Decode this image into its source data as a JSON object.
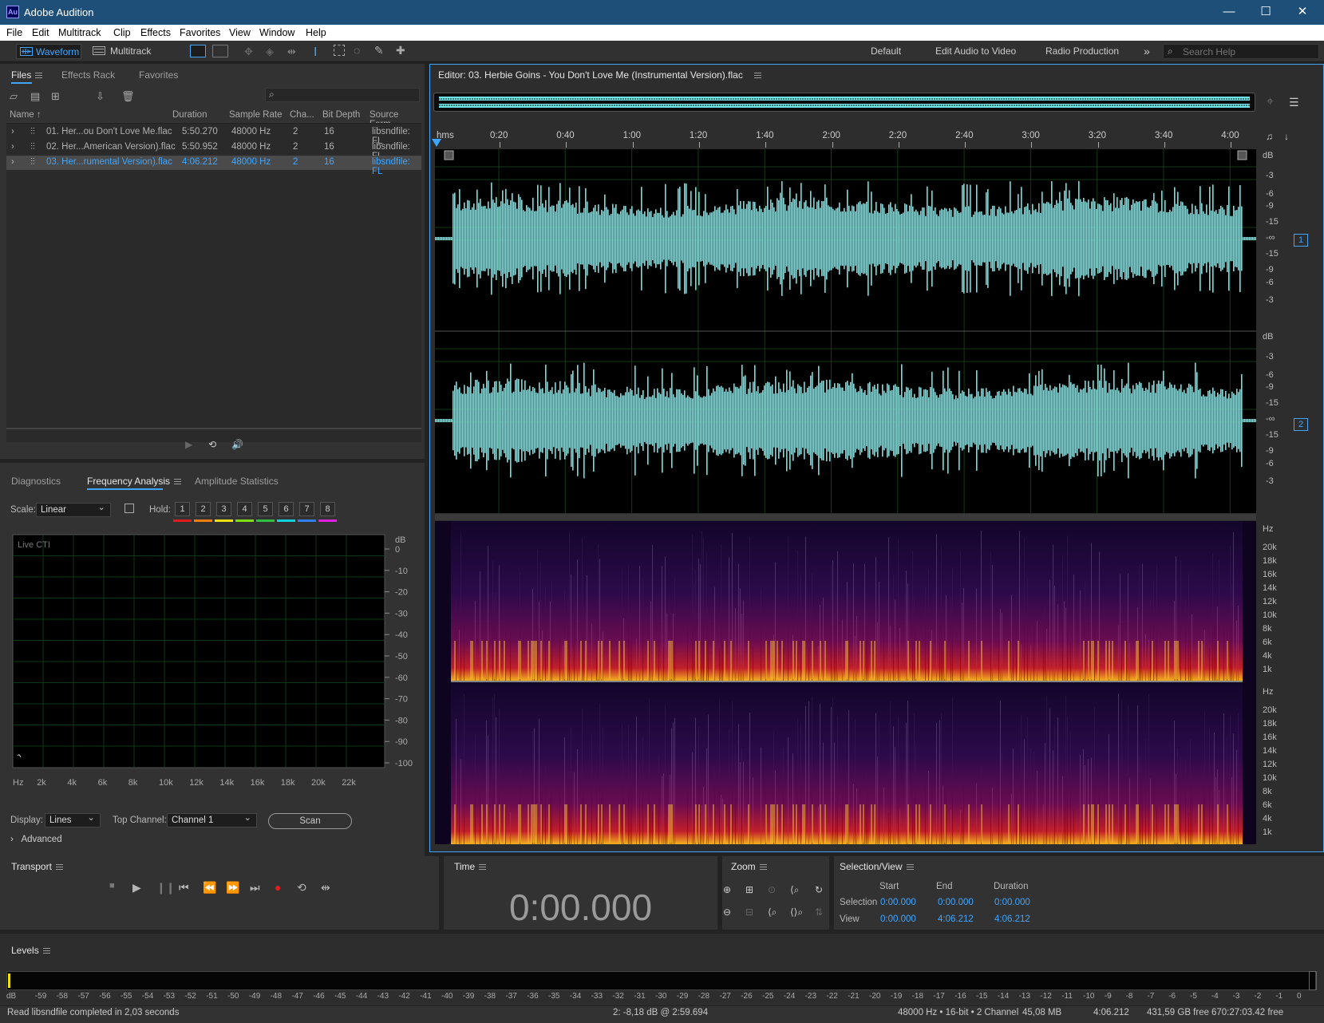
{
  "app": {
    "title": "Adobe Audition",
    "logo": "Au"
  },
  "window_controls": [
    "—",
    "☐",
    "✕"
  ],
  "menu": [
    "File",
    "Edit",
    "Multitrack",
    "Clip",
    "Effects",
    "Favorites",
    "View",
    "Window",
    "Help"
  ],
  "toolbar": {
    "waveform": "Waveform",
    "multitrack": "Multitrack",
    "workspaces": [
      "Default",
      "Edit Audio to Video",
      "Radio Production"
    ],
    "more": "»",
    "search_placeholder": "Search Help"
  },
  "files_panel": {
    "tabs": [
      "Files",
      "Effects Rack",
      "Favorites"
    ],
    "columns": [
      "Name ↑",
      "Duration",
      "Sample Rate",
      "Cha...",
      "Bit Depth",
      "Source Form..."
    ],
    "rows": [
      {
        "name": "01. Her...ou Don't Love Me.flac",
        "duration": "5:50.270",
        "rate": "48000 Hz",
        "ch": "2",
        "bits": "16",
        "src": "libsndfile: FL"
      },
      {
        "name": "02. Her...American Version).flac",
        "duration": "5:50.952",
        "rate": "48000 Hz",
        "ch": "2",
        "bits": "16",
        "src": "libsndfile: FL"
      },
      {
        "name": "03. Her...rumental Version).flac",
        "duration": "4:06.212",
        "rate": "48000 Hz",
        "ch": "2",
        "bits": "16",
        "src": "libsndfile: FL"
      }
    ]
  },
  "analysis_panel": {
    "tabs": [
      "Diagnostics",
      "Frequency Analysis",
      "Amplitude Statistics"
    ],
    "scale_label": "Scale:",
    "scale_value": "Linear",
    "hold_label": "Hold:",
    "holds": [
      "1",
      "2",
      "3",
      "4",
      "5",
      "6",
      "7",
      "8"
    ],
    "hold_colors": [
      "#e01b1b",
      "#f07d10",
      "#f0e010",
      "#7ee010",
      "#30c040",
      "#10d0e0",
      "#3080f0",
      "#e020e0"
    ],
    "graph_label": "Live CTI",
    "db_unit": "dB",
    "db_ticks": [
      "0",
      "-10",
      "-20",
      "-30",
      "-40",
      "-50",
      "-60",
      "-70",
      "-80",
      "-90",
      "-100"
    ],
    "hz_ticks": [
      "Hz",
      "2k",
      "4k",
      "6k",
      "8k",
      "10k",
      "12k",
      "14k",
      "16k",
      "18k",
      "20k",
      "22k"
    ],
    "display_label": "Display:",
    "display_value": "Lines",
    "top_channel_label": "Top Channel:",
    "top_channel_value": "Channel 1",
    "scan": "Scan",
    "advanced": "Advanced"
  },
  "editor": {
    "title": "Editor: 03. Herbie Goins - You Don't Love Me (Instrumental Version).flac",
    "time_unit": "hms",
    "time_ticks": [
      "0:20",
      "0:40",
      "1:00",
      "1:20",
      "1:40",
      "2:00",
      "2:20",
      "2:40",
      "3:00",
      "3:20",
      "3:40",
      "4:00"
    ],
    "db_unit": "dB",
    "db_labels": [
      "-3",
      "-6",
      "-9",
      "-15",
      "-∞",
      "-15",
      "-9",
      "-6",
      "-3"
    ],
    "channel_badges": [
      "1",
      "2"
    ],
    "hz_unit": "Hz",
    "hz_labels": [
      "20k",
      "18k",
      "16k",
      "14k",
      "12k",
      "10k",
      "8k",
      "6k",
      "4k",
      "1k"
    ]
  },
  "transport": {
    "title": "Transport"
  },
  "time_panel": {
    "title": "Time",
    "value": "0:00.000"
  },
  "zoom_panel": {
    "title": "Zoom"
  },
  "selection_panel": {
    "title": "Selection/View",
    "cols": [
      "Start",
      "End",
      "Duration"
    ],
    "selection_label": "Selection",
    "view_label": "View",
    "selection": [
      "0:00.000",
      "0:00.000",
      "0:00.000"
    ],
    "view": [
      "0:00.000",
      "4:06.212",
      "4:06.212"
    ]
  },
  "levels": {
    "title": "Levels",
    "ticks": [
      "dB",
      "-59",
      "-58",
      "-57",
      "-56",
      "-55",
      "-54",
      "-53",
      "-52",
      "-51",
      "-50",
      "-49",
      "-48",
      "-47",
      "-46",
      "-45",
      "-44",
      "-43",
      "-42",
      "-41",
      "-40",
      "-39",
      "-38",
      "-37",
      "-36",
      "-35",
      "-34",
      "-33",
      "-32",
      "-31",
      "-30",
      "-29",
      "-28",
      "-27",
      "-26",
      "-25",
      "-24",
      "-23",
      "-22",
      "-21",
      "-20",
      "-19",
      "-18",
      "-17",
      "-16",
      "-15",
      "-14",
      "-13",
      "-12",
      "-11",
      "-10",
      "-9",
      "-8",
      "-7",
      "-6",
      "-5",
      "-4",
      "-3",
      "-2",
      "-1",
      "0"
    ]
  },
  "status": {
    "message": "Read libsndfile completed in 2,03 seconds",
    "cursor": "2: -8,18 dB @ 2:59.694",
    "format": "48000 Hz • 16-bit • 2 Channel",
    "size": "45,08 MB",
    "duration": "4:06.212",
    "free": "431,59 GB free",
    "time_free": "670:27:03.42 free"
  },
  "colors": {
    "accent": "#3ea6ff",
    "waveform": "#6fe3e3",
    "titlebar": "#1e4f78"
  }
}
